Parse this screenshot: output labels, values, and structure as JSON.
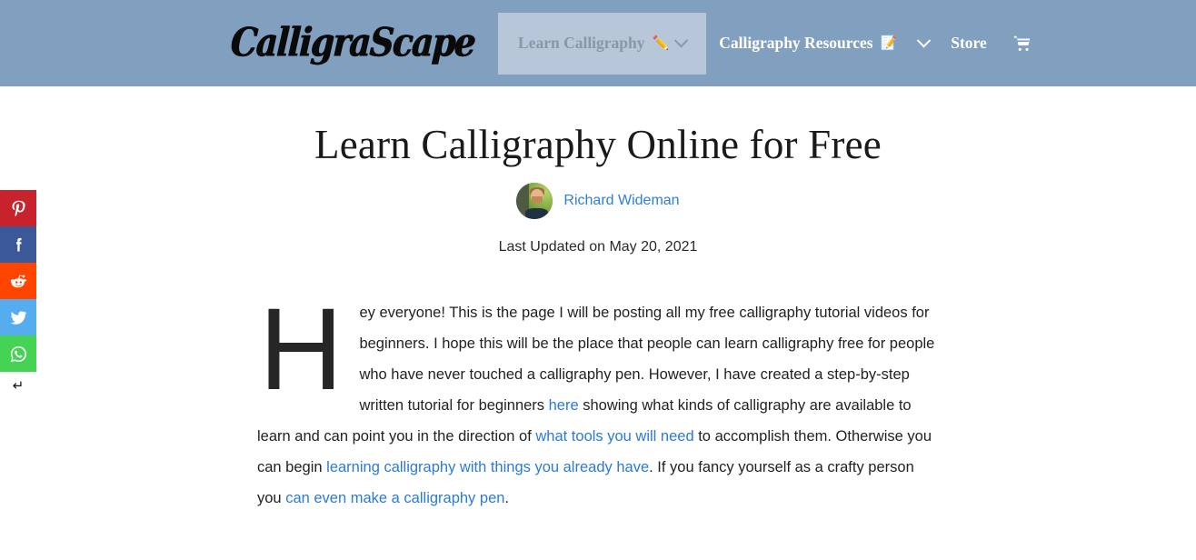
{
  "header": {
    "logo_text": "CalligraScape",
    "background_color": "#81a0c0",
    "nav": [
      {
        "label": "Learn Calligraphy",
        "emoji": "✏️",
        "emoji_name": "pencil-icon",
        "active": true,
        "has_chevron": true
      },
      {
        "label": "Calligraphy Resources",
        "emoji": "📝",
        "emoji_name": "memo-icon",
        "active": false,
        "has_chevron": true
      },
      {
        "label": "Store",
        "emoji": "",
        "emoji_name": "",
        "active": false,
        "has_chevron": false
      }
    ],
    "cart_icon": "shopping-cart-icon"
  },
  "share_rail": {
    "buttons": [
      {
        "name": "pinterest",
        "label": "Pinterest",
        "color": "#c8232c"
      },
      {
        "name": "facebook",
        "label": "Facebook",
        "color": "#3b5998"
      },
      {
        "name": "reddit",
        "label": "Reddit",
        "color": "#ff4500"
      },
      {
        "name": "twitter",
        "label": "Twitter",
        "color": "#55acee"
      },
      {
        "name": "whatsapp",
        "label": "WhatsApp",
        "color": "#45d354"
      }
    ],
    "hide_label": "↵",
    "hide_name": "hide-share-arrow-icon"
  },
  "article": {
    "title": "Learn Calligraphy Online for Free",
    "author": "Richard Wideman",
    "author_link_color": "#2f7fd4",
    "updated": "Last Updated on May 20, 2021",
    "dropcap": "H",
    "link_color": "#2b7bd6",
    "paragraph": {
      "part1": "ey everyone! This is the page I will be posting all my free calligraphy tutorial videos for beginners. I hope this will be the place that people can learn calligraphy free for people who have never touched a calligraphy pen. However, I have created a step-by-step written tutorial for beginners ",
      "link1": "here",
      "part2": " showing what kinds of calligraphy are available to learn and can point you in the direction of ",
      "link2": "what tools you will need",
      "part3": " to accomplish them. Otherwise you can begin ",
      "link3": "learning calligraphy with things you already have",
      "part4": ". If you fancy yourself as a crafty person you ",
      "link4": "can even make a calligraphy pen",
      "part5": "."
    }
  }
}
